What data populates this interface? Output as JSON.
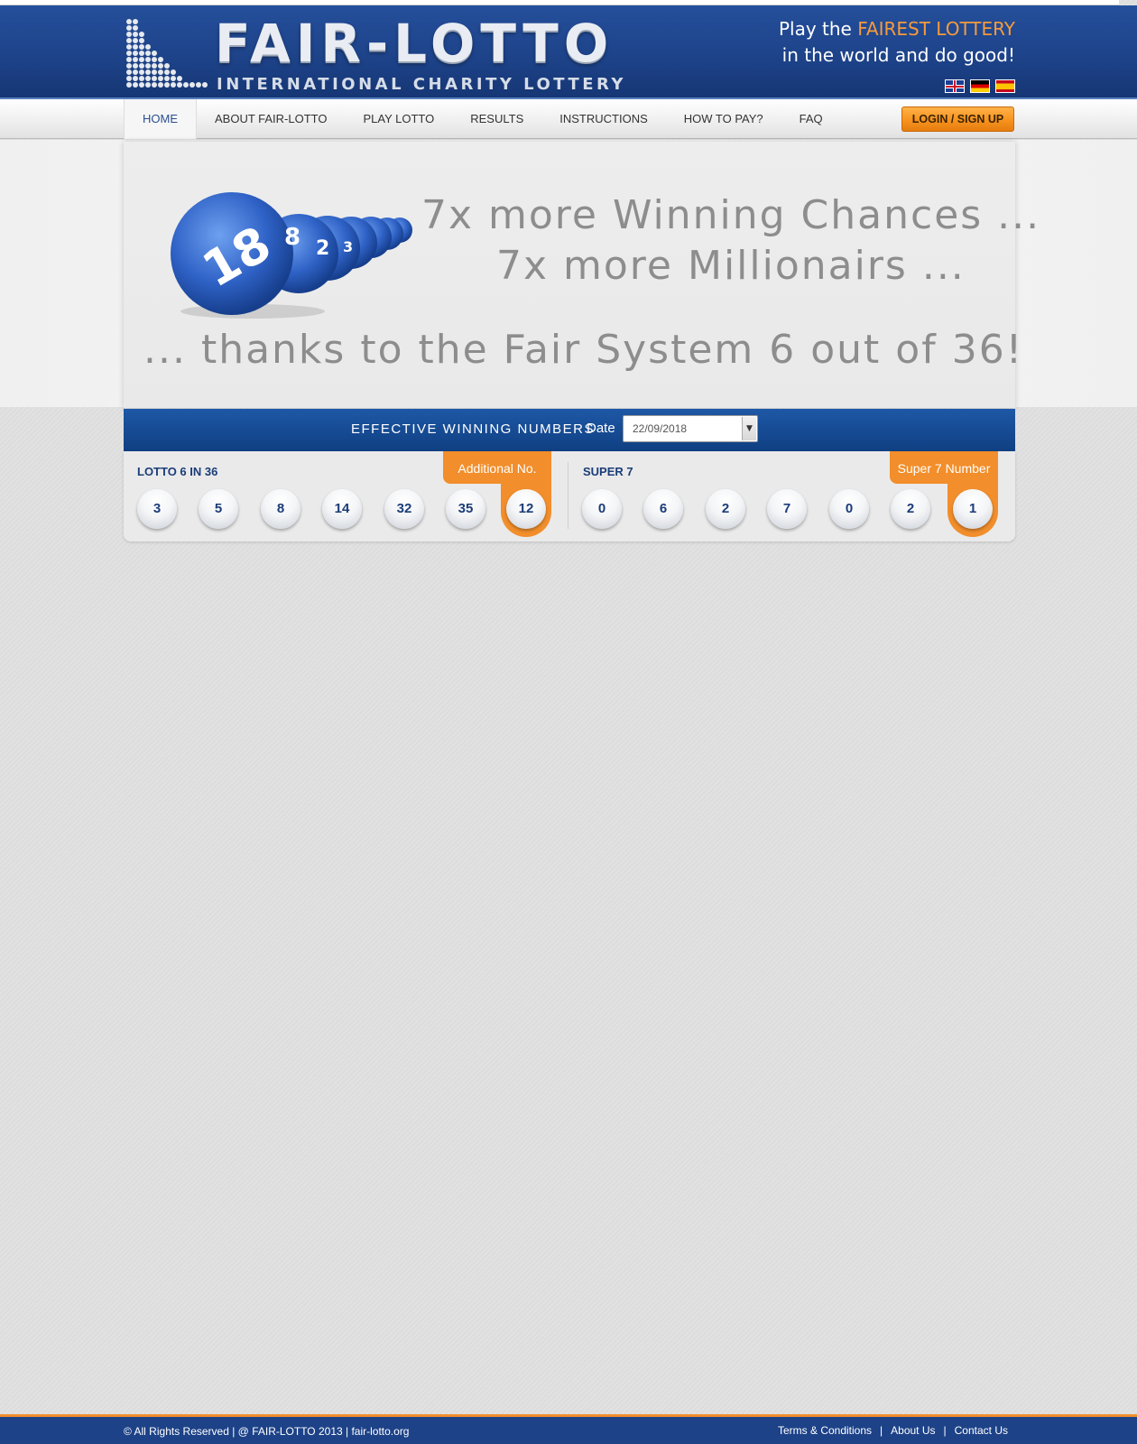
{
  "header": {
    "logo_title": "FAIR-LOTTO",
    "logo_subtitle": "INTERNATIONAL CHARITY LOTTERY",
    "tagline_pre": "Play the ",
    "tagline_highlight": "FAIREST LOTTERY",
    "tagline_line2": "in the world and do good!",
    "flags": [
      "uk-flag-icon",
      "germany-flag-icon",
      "spain-flag-icon"
    ]
  },
  "nav": {
    "items": [
      "HOME",
      "ABOUT FAIR-LOTTO",
      "PLAY LOTTO",
      "RESULTS",
      "INSTRUCTIONS",
      "HOW TO PAY?",
      "FAQ"
    ],
    "active": "HOME",
    "login": "LOGIN / SIGN UP"
  },
  "banner": {
    "line1": "7x more Winning Chances ...",
    "line2": "7x more Millionairs ...",
    "line3": "... thanks to the Fair System 6 out of 36!"
  },
  "winning": {
    "title": "EFFECTIVE WINNING NUMBERS",
    "date_label": "Date",
    "date_value": "22/09/2018",
    "lotto": {
      "label": "LOTTO 6 IN 36",
      "numbers": [
        "3",
        "5",
        "8",
        "14",
        "32",
        "35"
      ],
      "additional_label": "Additional No.",
      "additional": "12"
    },
    "super7": {
      "label": "SUPER 7",
      "numbers": [
        "0",
        "6",
        "2",
        "7",
        "0",
        "2"
      ],
      "super_label": "Super 7 Number",
      "super": "1"
    }
  },
  "footer": {
    "copyright": "© All Rights Reserved | @ FAIR-LOTTO 2013 | fair-lotto.org",
    "links": [
      "Terms & Conditions",
      "About Us",
      "Contact Us"
    ]
  },
  "colors": {
    "brand_blue": "#1d4288",
    "accent_orange": "#f28e2b",
    "ball_text": "#1b3d78"
  }
}
